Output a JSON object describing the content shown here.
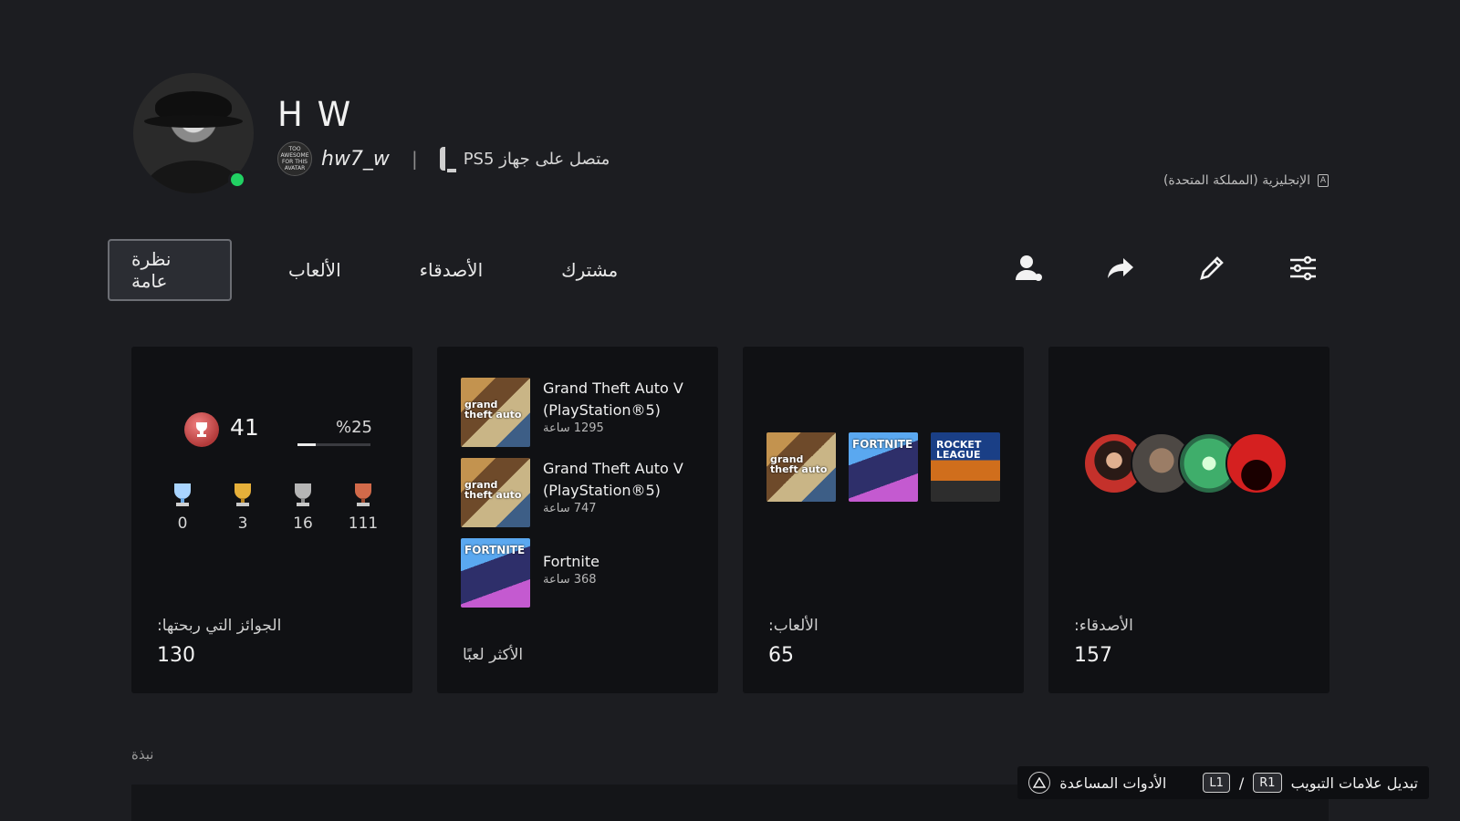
{
  "profile": {
    "display_name": "H W",
    "mini_avatar_text": "TOO AWESOME FOR THIS AVATAR",
    "online_id": "hw7_w",
    "status": "متصل على جهاز PS5",
    "language": "الإنجليزية (المملكة المتحدة)"
  },
  "tabs": [
    {
      "label": "نظرة عامة"
    },
    {
      "label": "الألعاب"
    },
    {
      "label": "الأصدقاء"
    },
    {
      "label": "مشترك"
    }
  ],
  "trophies": {
    "level": "41",
    "progress_label": "%25",
    "progress": 0.25,
    "counts": {
      "platinum": "0",
      "gold": "3",
      "silver": "16",
      "bronze": "111"
    },
    "label": "الجوائز التي ربحتها:",
    "total": "130"
  },
  "most_played": {
    "label": "الأكثر لعبًا",
    "items": [
      {
        "title1": "Grand Theft Auto V",
        "title2": "(PlayStation®5)",
        "hours": "1295 ساعة"
      },
      {
        "title1": "Grand Theft Auto V",
        "title2": "(PlayStation®5)",
        "hours": "747 ساعة"
      },
      {
        "title1": "Fortnite",
        "title2": "",
        "hours": "368 ساعة"
      }
    ]
  },
  "games": {
    "label": "الألعاب:",
    "count": "65"
  },
  "friends": {
    "label": "الأصدقاء:",
    "count": "157"
  },
  "bio": {
    "label": "نبذة"
  },
  "hints": {
    "tab_switch": "تبديل علامات التبويب",
    "r1": "R1",
    "l1": "L1",
    "slash": "/",
    "tools": "الأدوات المساعدة"
  },
  "colors": {
    "online": "#21d163",
    "card_bg": "#101114",
    "page_bg": "#1c1d21"
  }
}
